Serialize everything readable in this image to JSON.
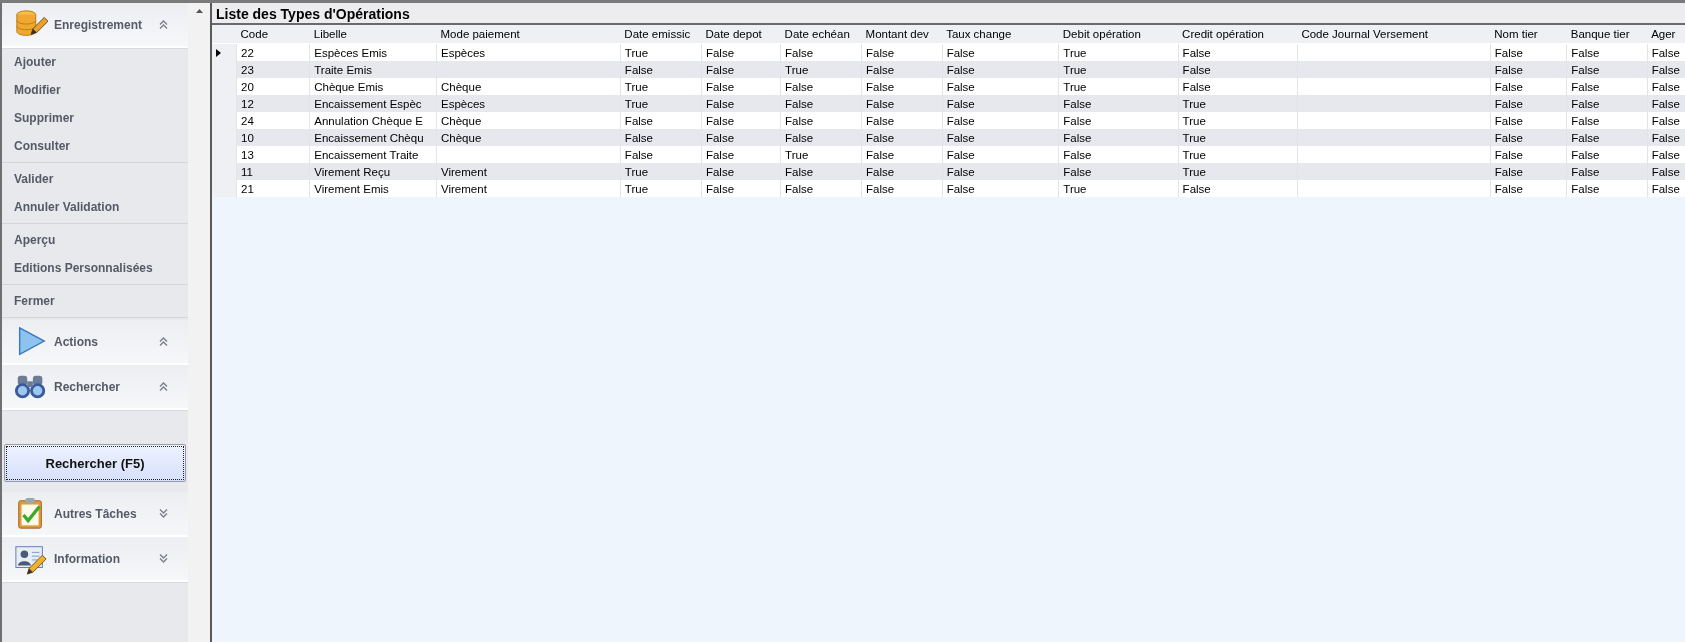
{
  "sidebar": {
    "groups": [
      {
        "title": "Enregistrement",
        "expanded": true,
        "item_groups": [
          [
            "Ajouter",
            "Modifier",
            "Supprimer",
            "Consulter"
          ],
          [
            "Valider",
            "Annuler Validation"
          ],
          [
            "Aperçu",
            "Editions Personnalisées"
          ],
          [
            "Fermer"
          ]
        ]
      },
      {
        "title": "Actions",
        "expanded": true
      },
      {
        "title": "Rechercher",
        "expanded": true,
        "button": "Rechercher (F5)"
      },
      {
        "title": "Autres Tâches",
        "expanded": false
      },
      {
        "title": "Information",
        "expanded": false
      }
    ]
  },
  "grid": {
    "title": "Liste des Types d'Opérations",
    "columns": [
      "Code",
      "Libelle",
      "Mode paiement",
      "Date emissic",
      "Date depot",
      "Date echéan",
      "Montant dev",
      "Taux change",
      "Debit opération",
      "Credit opération",
      "Code Journal Versement",
      "Nom tier",
      "Banque tier",
      "Ager"
    ],
    "rows": [
      {
        "selected": true,
        "cells": [
          "22",
          "Espèces Emis",
          "Espèces",
          "True",
          "False",
          "False",
          "False",
          "False",
          "True",
          "False",
          null,
          "False",
          "False",
          "False"
        ]
      },
      {
        "selected": false,
        "cells": [
          "23",
          "Traite Emis",
          null,
          "False",
          "False",
          "True",
          "False",
          "False",
          "True",
          "False",
          null,
          "False",
          "False",
          "False"
        ]
      },
      {
        "selected": false,
        "cells": [
          "20",
          "Chèque Emis",
          "Chèque",
          "True",
          "False",
          "False",
          "False",
          "False",
          "True",
          "False",
          null,
          "False",
          "False",
          "False"
        ]
      },
      {
        "selected": false,
        "cells": [
          "12",
          "Encaissement Espèc",
          "Espèces",
          "True",
          "False",
          "False",
          "False",
          "False",
          "False",
          "True",
          null,
          "False",
          "False",
          "False"
        ]
      },
      {
        "selected": false,
        "cells": [
          "24",
          "Annulation Chèque E",
          "Chèque",
          "False",
          "False",
          "False",
          "False",
          "False",
          "False",
          "True",
          null,
          "False",
          "False",
          "False"
        ]
      },
      {
        "selected": false,
        "cells": [
          "10",
          "Encaissement Chèqu",
          "Chèque",
          "False",
          "False",
          "False",
          "False",
          "False",
          "False",
          "True",
          null,
          "False",
          "False",
          "False"
        ]
      },
      {
        "selected": false,
        "cells": [
          "13",
          "Encaissement Traite",
          null,
          "False",
          "False",
          "True",
          "False",
          "False",
          "False",
          "True",
          null,
          "False",
          "False",
          "False"
        ]
      },
      {
        "selected": false,
        "cells": [
          "11",
          "Virement Reçu",
          "Virement",
          "True",
          "False",
          "False",
          "False",
          "False",
          "False",
          "True",
          null,
          "False",
          "False",
          "False"
        ]
      },
      {
        "selected": false,
        "cells": [
          "21",
          "Virement Emis",
          "Virement",
          "True",
          "False",
          "False",
          "False",
          "False",
          "True",
          "False",
          null,
          "False",
          "False",
          "False"
        ]
      }
    ]
  }
}
